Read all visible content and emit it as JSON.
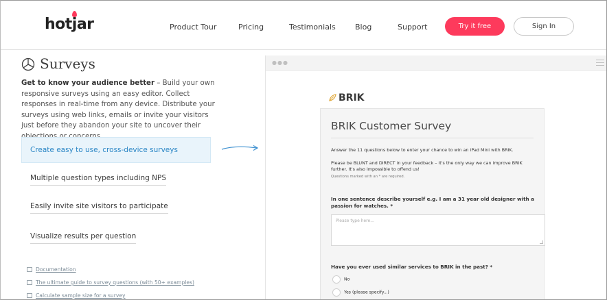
{
  "header": {
    "logo": "hotjar",
    "nav": [
      "Product Tour",
      "Pricing",
      "Testimonials",
      "Blog",
      "Support"
    ],
    "try_label": "Try it free",
    "sign_in_label": "Sign In"
  },
  "main": {
    "title": "Surveys",
    "intro_bold": "Get to know your audience better",
    "intro_rest": " – Build your own responsive surveys using an easy editor. Collect responses in real-time from any device. Distribute your surveys using web links, emails or invite your visitors just before they abandon your site to uncover their objections or concerns.",
    "features": [
      "Create easy to use, cross-device surveys",
      "Multiple question types including NPS",
      "Easily invite site visitors to participate",
      "Visualize results per question"
    ],
    "active_feature_index": 0,
    "links": [
      "Documentation",
      "The ultimate guide to survey questions (with 50+ examples)",
      "Calculate sample size for a survey"
    ]
  },
  "preview": {
    "brand": "BRIK",
    "survey_title": "BRIK Customer Survey",
    "intro_line": "Answer the 11 questions below to enter your chance to win an iPad Mini with BRIK.",
    "feedback_line": "Please be BLUNT and DIRECT in your feedback – it's the only way we can improve BRIK further. It's also impossible to offend us!",
    "required_note": "Questions marked with an * are required.",
    "q1": "In one sentence describe yourself e.g. I am a 31 year old designer with a passion for watches. *",
    "q1_placeholder": "Please type here...",
    "q2": "Have you ever used similar services to BRIK in the past? *",
    "q2_options": [
      "No",
      "Yes (please specify...)"
    ]
  },
  "colors": {
    "accent": "#fd3a5c",
    "link_blue": "#2d87c6",
    "active_bg": "#e9f4fb"
  }
}
